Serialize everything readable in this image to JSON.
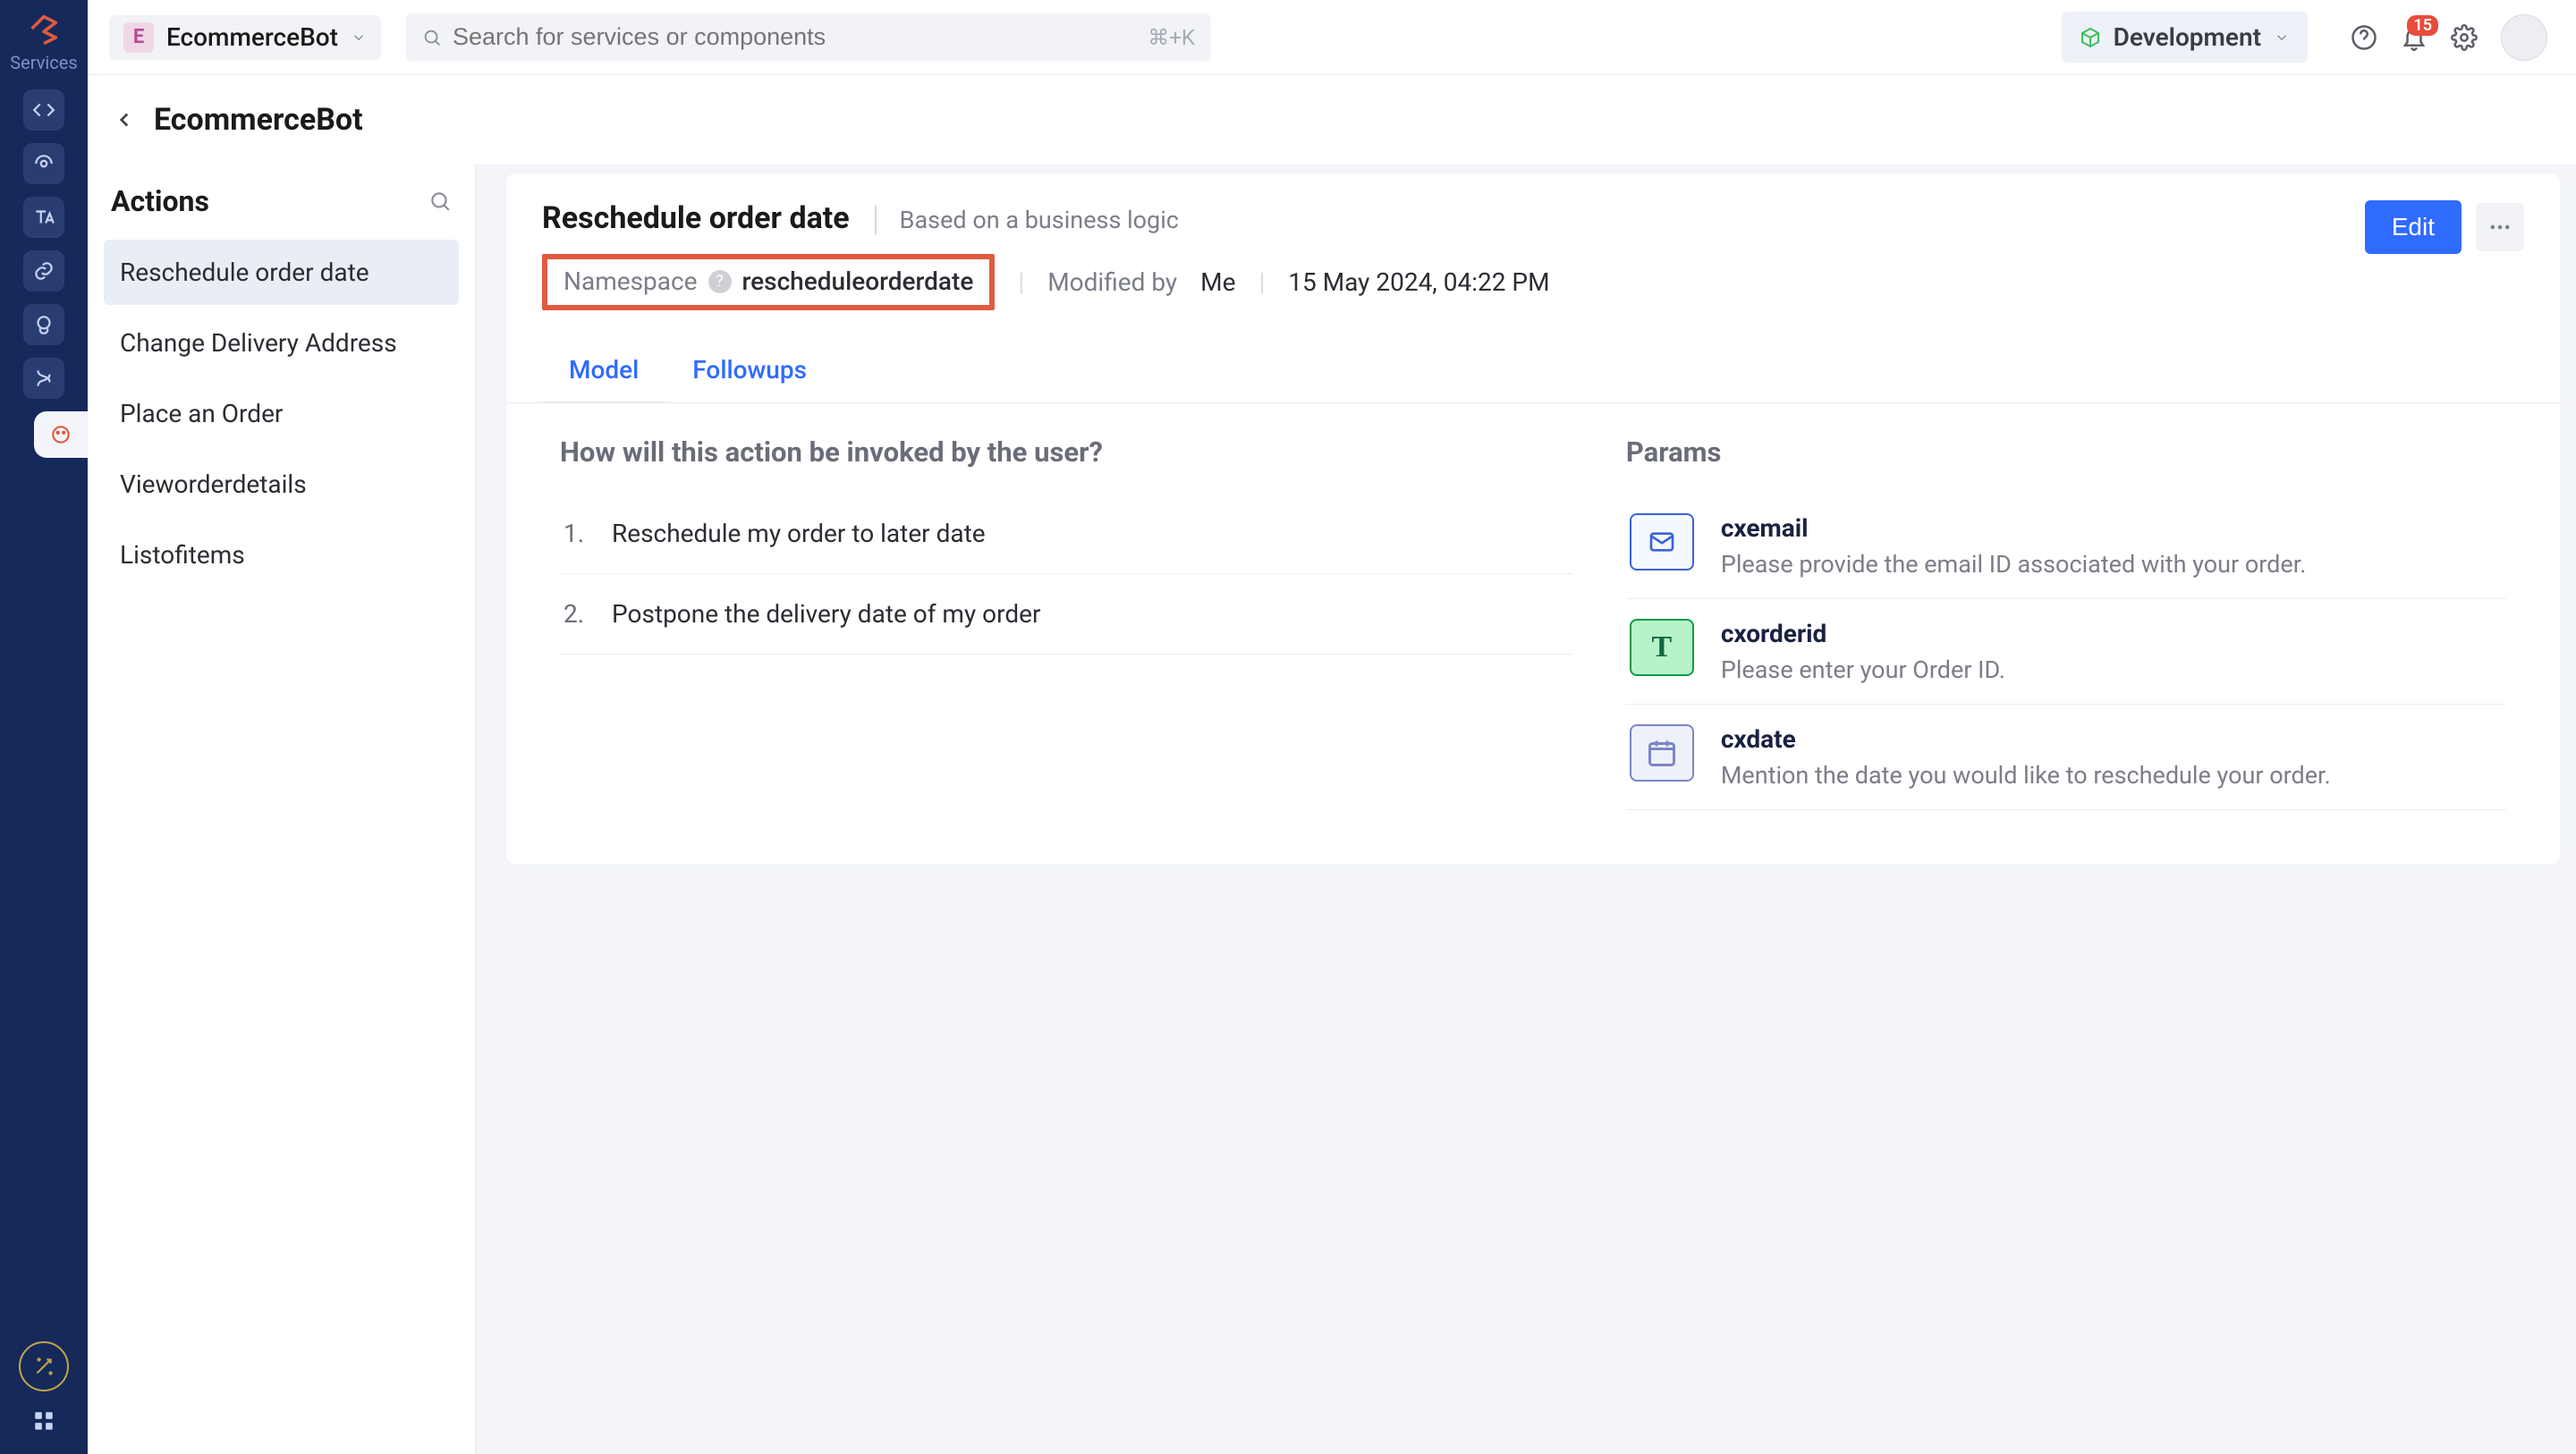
{
  "topbar": {
    "app_badge_letter": "E",
    "app_name": "EcommerceBot",
    "search_placeholder": "Search for services or components",
    "search_shortcut": "⌘+K",
    "environment": "Development",
    "notification_count": "15"
  },
  "rail": {
    "services_label": "Services"
  },
  "breadcrumb": {
    "title": "EcommerceBot"
  },
  "sidebar": {
    "heading": "Actions",
    "items": [
      "Reschedule order date",
      "Change Delivery Address",
      "Place an Order",
      "Vieworderdetails",
      "Listofitems"
    ]
  },
  "action": {
    "title": "Reschedule order date",
    "subtitle": "Based on a business logic",
    "namespace_label": "Namespace",
    "namespace_value": "rescheduleorderdate",
    "modified_by_label": "Modified by",
    "modified_by_value": "Me",
    "modified_at": "15 May 2024, 04:22 PM",
    "edit_button": "Edit",
    "tabs": {
      "model": "Model",
      "followups": "Followups"
    },
    "invoke_title": "How will this action be invoked by the user?",
    "invocations": [
      "Reschedule my order to later date",
      "Postpone the delivery date of my order"
    ],
    "params_title": "Params",
    "params": [
      {
        "name": "cxemail",
        "desc": "Please provide the email ID associated with your order."
      },
      {
        "name": "cxorderid",
        "desc": "Please enter your Order ID."
      },
      {
        "name": "cxdate",
        "desc": "Mention the date you would like to reschedule your order."
      }
    ]
  }
}
